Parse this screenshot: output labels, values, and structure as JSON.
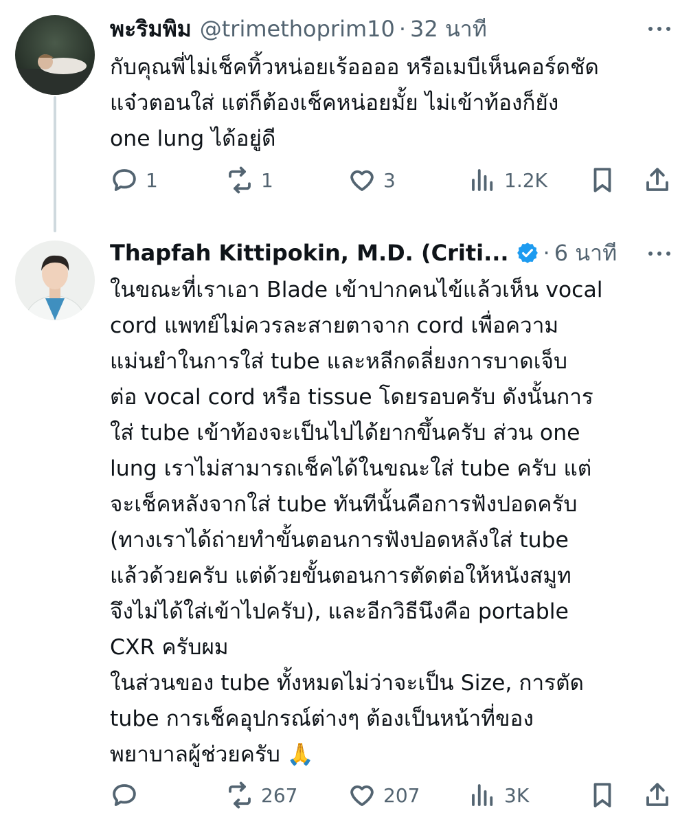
{
  "tweets": [
    {
      "name": "พะริมพิม",
      "handle": "@trimethoprim10",
      "time": "32 นาที",
      "text": "กับคุณพี่ไม่เช็คทิ้วหน่อยเร้ออออ หรือเมบีเห็นคอร์ดชัด\nแจ๋วตอนใส่ แต่ก็ต้องเช็คหน่อยมั้ย ไม่เข้าท้องก็ยัง\none lung ได้อยู่ดี",
      "stats": {
        "replies": "1",
        "reposts": "1",
        "likes": "3",
        "views": "1.2K"
      }
    },
    {
      "name": "Thapfah Kittipokin, M.D. (Criti...",
      "verified": true,
      "time": "6 นาที",
      "text": "ในขณะที่เราเอา Blade เข้าปากคนไข้แล้วเห็น vocal\ncord แพทย์ไม่ควรละสายตาจาก cord เพื่อความ\nแม่นยำในการใส่ tube และหลีกดลี่ยงการบาดเจ็บ\nต่อ vocal cord หรือ tissue โดยรอบครับ ดังนั้นการ\nใส่ tube เข้าท้องจะเป็นไปได้ยากขึ้นครับ ส่วน one\nlung เราไม่สามารถเช็คได้ในขณะใส่ tube ครับ แต่\nจะเช็คหลังจากใส่ tube ทันทีนั้นคือการฟังปอดครับ\n(ทางเราได้ถ่ายทำขั้นตอนการฟังปอดหลังใส่ tube\nแล้วด้วยครับ แต่ด้วยขั้นตอนการตัดต่อให้หนังสมูท\nจึงไม่ได้ใส่เข้าไปครับ), และอีกวิธีนึงคือ portable\nCXR ครับผม\nในส่วนของ tube ทั้งหมดไม่ว่าจะเป็น Size, การตัด\ntube การเช็คอุปกรณ์ต่างๆ ต้องเป็นหน้าที่ของ\nพยาบาลผู้ช่วยครับ 🙏",
      "stats": {
        "replies": "",
        "reposts": "267",
        "likes": "207",
        "views": "3K"
      }
    }
  ],
  "icons": {
    "reply": "reply-icon",
    "repost": "repost-icon",
    "like": "heart-icon",
    "views": "views-icon",
    "bookmark": "bookmark-icon",
    "share": "share-icon",
    "more": "more-icon",
    "verified": "verified-badge-icon"
  },
  "colors": {
    "text": "#0f1419",
    "muted": "#536471",
    "verified": "#1d9bf0",
    "thread_line": "#cfd9de"
  }
}
